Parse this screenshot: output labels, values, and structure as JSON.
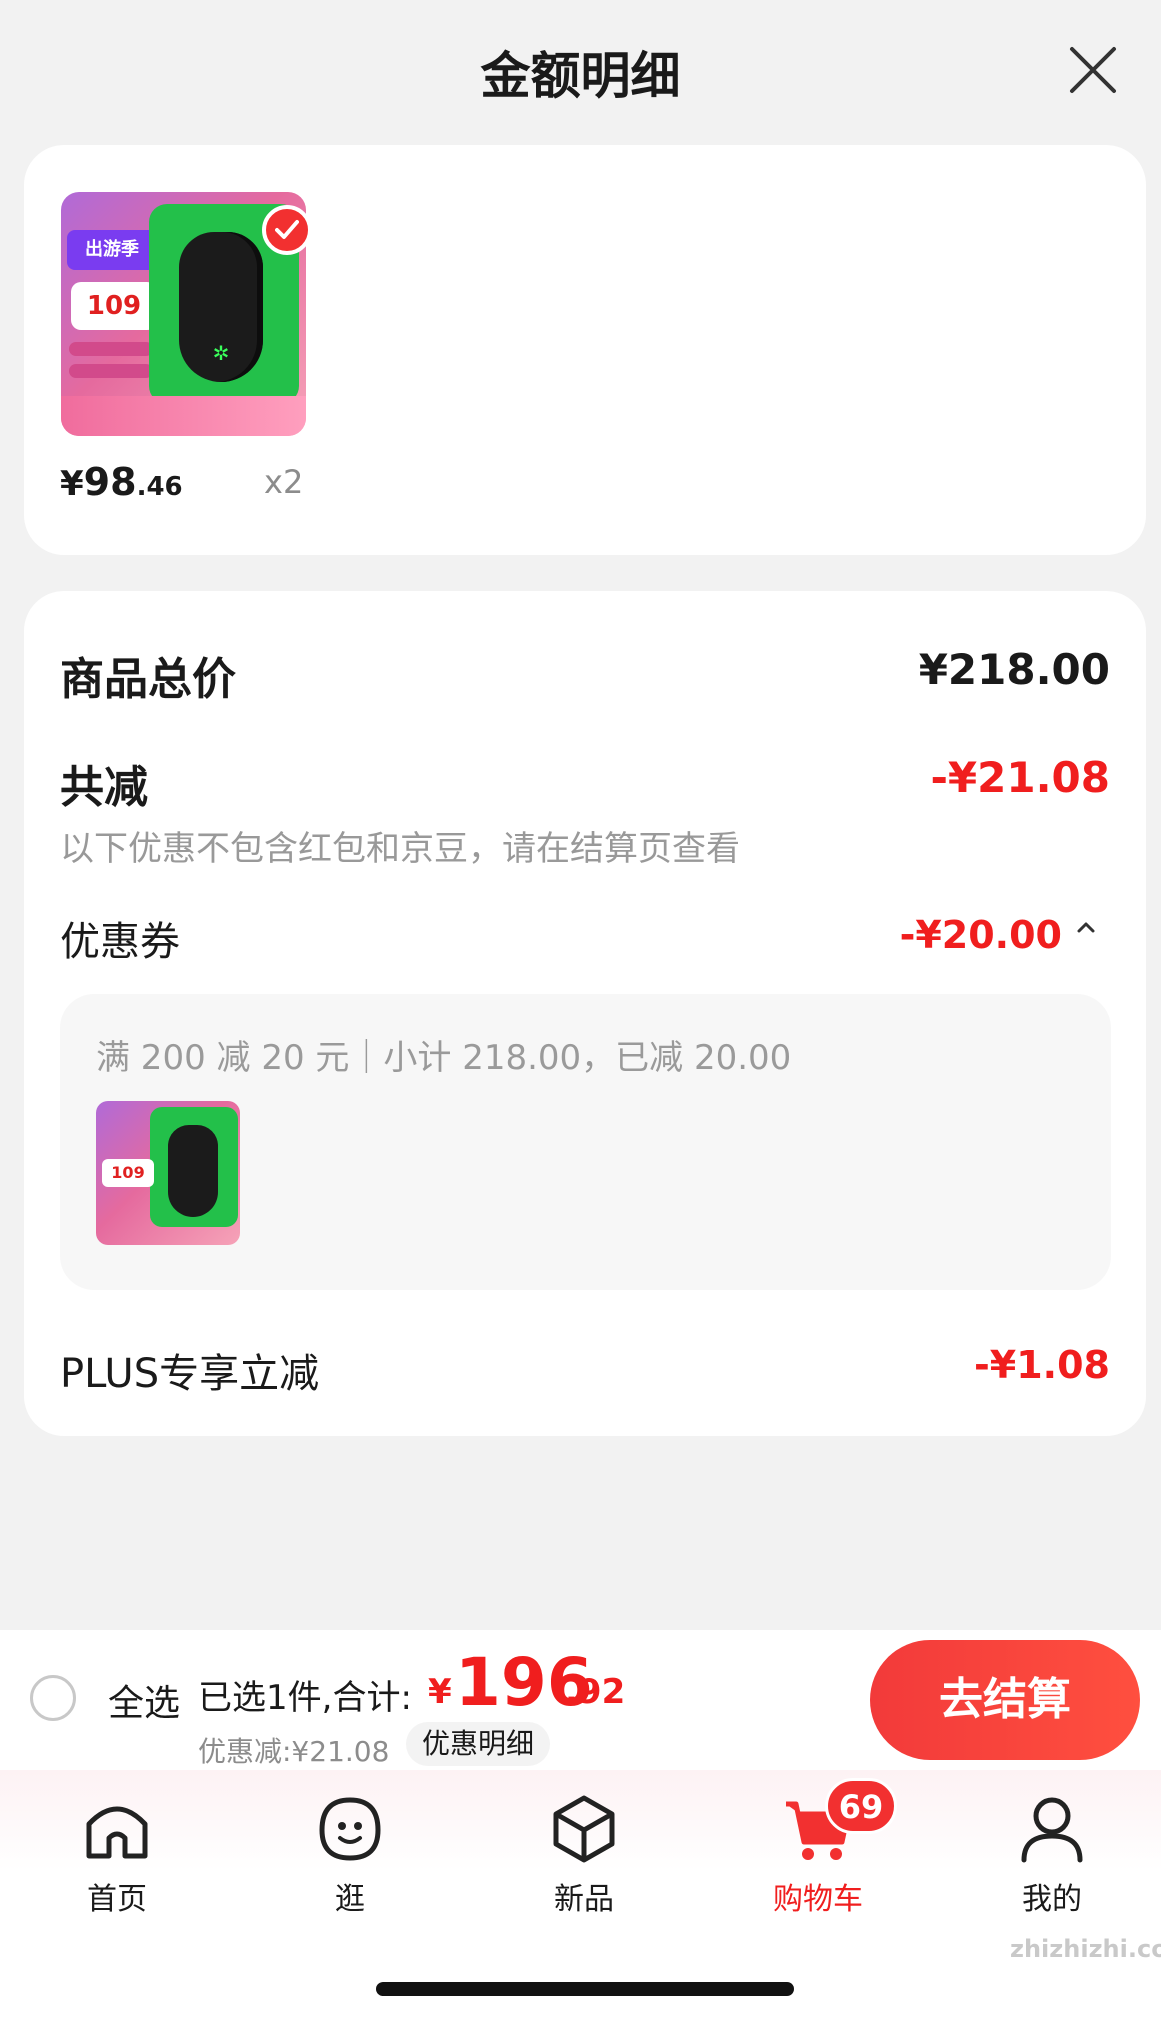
{
  "header": {
    "title": "金额明细"
  },
  "product": {
    "price_yuan": "¥",
    "price_int": "98",
    "price_dec": ".46",
    "quantity": "x2",
    "thumb_badge": "109",
    "thumb_tag": "出游季"
  },
  "summary": {
    "total_label": "商品总价",
    "total_value": "¥218.00",
    "reduce_label": "共减",
    "reduce_value": "-¥21.08",
    "note": "以下优惠不包含红包和京豆，请在结算页查看",
    "coupon_label": "优惠券",
    "coupon_value": "-¥20.00",
    "coupon_detail": "满 200 减 20 元｜小计 218.00，已减 20.00",
    "plus_label": "PLUS专享立减",
    "plus_value": "-¥1.08"
  },
  "checkout": {
    "select_all": "全选",
    "selected_text": "已选1件,合计:",
    "total_yuan": "¥",
    "total_int": "196",
    "total_dec": ".92",
    "discount_line": "优惠减:¥21.08",
    "detail_button": "优惠明细",
    "checkout_button": "去结算"
  },
  "tabbar": {
    "tabs": [
      {
        "label": "首页",
        "icon": "home-icon"
      },
      {
        "label": "逛",
        "icon": "face-icon"
      },
      {
        "label": "新品",
        "icon": "cube-icon"
      },
      {
        "label": "购物车",
        "icon": "cart-icon"
      },
      {
        "label": "我的",
        "icon": "user-icon"
      }
    ],
    "active_index": 3,
    "cart_badge": "69"
  },
  "watermark": "zhizhizhi.com",
  "colors": {
    "accent": "#f01e1e",
    "background": "#f2f2f2"
  }
}
